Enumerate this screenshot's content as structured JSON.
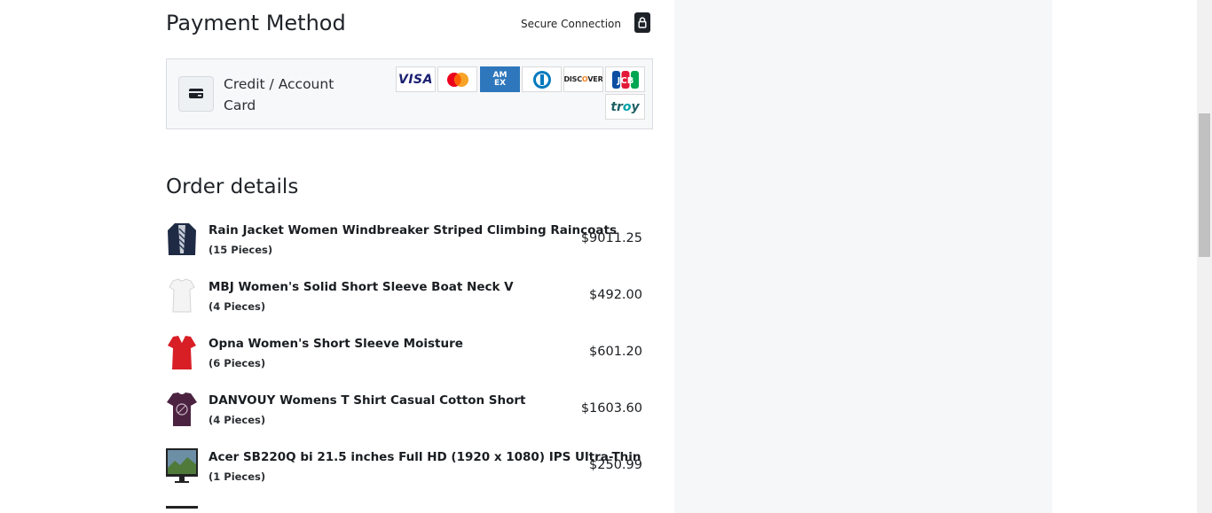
{
  "payment": {
    "title": "Payment Method",
    "secure_label": "Secure Connection",
    "option_label": "Credit / Account Card",
    "brands": [
      {
        "name": "VISA",
        "icon": "visa-logo"
      },
      {
        "name": "Mastercard",
        "icon": "mastercard-logo"
      },
      {
        "name": "AMEX",
        "icon": "amex-logo"
      },
      {
        "name": "Diners Club",
        "icon": "diners-logo"
      },
      {
        "name": "DISCOVER",
        "icon": "discover-logo"
      },
      {
        "name": "JCB",
        "icon": "jcb-logo"
      },
      {
        "name": "troy",
        "icon": "troy-logo"
      }
    ]
  },
  "order": {
    "title": "Order details",
    "items": [
      {
        "name": "Rain Jacket Women Windbreaker Striped Climbing Raincoats",
        "qty": "(15 Pieces)",
        "price": "$9011.25",
        "thumb": "jacket-thumbnail"
      },
      {
        "name": "MBJ Women's Solid Short Sleeve Boat Neck V",
        "qty": "(4 Pieces)",
        "price": "$492.00",
        "thumb": "white-shirt-thumbnail"
      },
      {
        "name": "Opna Women's Short Sleeve Moisture",
        "qty": "(6 Pieces)",
        "price": "$601.20",
        "thumb": "red-shirt-thumbnail"
      },
      {
        "name": "DANVOUY Womens T Shirt Casual Cotton Short",
        "qty": "(4 Pieces)",
        "price": "$1603.60",
        "thumb": "purple-shirt-thumbnail"
      },
      {
        "name": "Acer SB220Q bi 21.5 inches Full HD (1920 x 1080) IPS Ultra-Thin",
        "qty": "(1 Pieces)",
        "price": "$250.99",
        "thumb": "monitor-thumbnail"
      }
    ]
  },
  "colors": {
    "panel_bg": "#f6f7f9",
    "card_box_bg": "#f7f8fa",
    "text": "#1f2328"
  }
}
